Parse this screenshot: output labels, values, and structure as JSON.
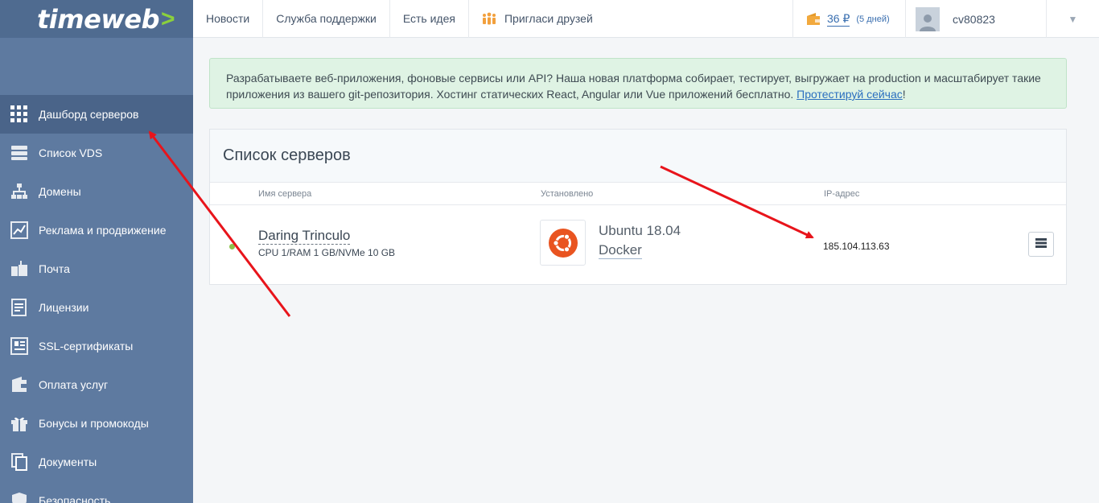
{
  "brand": {
    "logo_text": "timeweb",
    "logo_arrow": ">"
  },
  "sidebar": {
    "items": [
      {
        "label": "Дашборд серверов",
        "icon": "grid-icon",
        "active": true
      },
      {
        "label": "Список VDS",
        "icon": "server-icon"
      },
      {
        "label": "Домены",
        "icon": "sitemap-icon"
      },
      {
        "label": "Реклама и продвижение",
        "icon": "chart-icon"
      },
      {
        "label": "Почта",
        "icon": "mailbox-icon"
      },
      {
        "label": "Лицензии",
        "icon": "document-icon"
      },
      {
        "label": "SSL-сертификаты",
        "icon": "certificate-icon"
      },
      {
        "label": "Оплата услуг",
        "icon": "wallet-icon"
      },
      {
        "label": "Бонусы и промокоды",
        "icon": "gift-icon"
      },
      {
        "label": "Документы",
        "icon": "documents-icon"
      },
      {
        "label": "Безопасность",
        "icon": "shield-icon"
      }
    ]
  },
  "topbar": {
    "links": [
      "Новости",
      "Служба поддержки",
      "Есть идея",
      "Пригласи друзей"
    ],
    "balance_amount": "36 ₽",
    "balance_days": "(5 дней)",
    "username": "cv80823",
    "dropdown_glyph": "▼"
  },
  "notice": {
    "text": "Разрабатываете веб-приложения, фоновые сервисы или API? Наша новая платформа собирает, тестирует, выгружает на production и масштабирует такие приложения из вашего git-репозитория. Хостинг статических React, Angular или Vue приложений бесплатно. ",
    "link": "Протестируй сейчас",
    "suffix": "!"
  },
  "servers": {
    "title": "Список серверов",
    "columns": {
      "name": "Имя сервера",
      "installed": "Установлено",
      "ip": "IP-адрес"
    },
    "rows": [
      {
        "name": "Daring Trinculo",
        "spec": "CPU 1/RAM 1 GB/NVMe 10 GB",
        "os": "Ubuntu 18.04",
        "app": "Docker",
        "ip": "185.104.113.63",
        "status": "online"
      }
    ]
  },
  "colors": {
    "sidebar": "#5e7aa0",
    "sidebar_active": "#4a6489",
    "accent_green": "#8bd03c",
    "ubuntu": "#e95420",
    "annotation_arrow": "#e8141b"
  }
}
